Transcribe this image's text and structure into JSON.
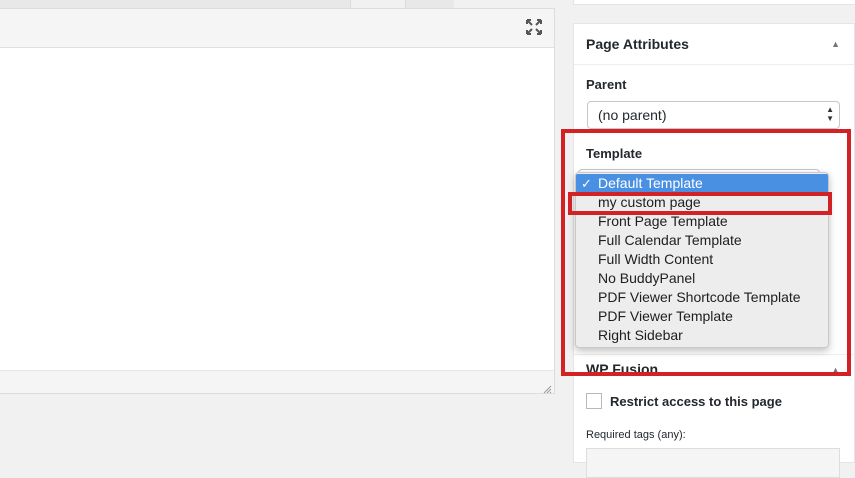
{
  "editor": {
    "fullscreen_icon": "expand-icon"
  },
  "page_attributes": {
    "title": "Page Attributes",
    "collapse_icon": "triangle-up-icon",
    "parent_label": "Parent",
    "parent_value": "(no parent)",
    "template_label": "Template",
    "template_options": [
      "Default Template",
      "my custom page",
      "Front Page Template",
      "Full Calendar Template",
      "Full Width Content",
      "No BuddyPanel",
      "PDF Viewer Shortcode Template",
      "PDF Viewer Template",
      "Right Sidebar"
    ],
    "selected_option_check": "✓"
  },
  "wp_fusion": {
    "title": "WP Fusion",
    "collapse_icon": "triangle-up-icon",
    "restrict_label": "Restrict access to this page",
    "required_tags_label": "Required tags (any):"
  },
  "colors": {
    "annotation": "#d32226",
    "selected_option": "#4a90e2"
  }
}
